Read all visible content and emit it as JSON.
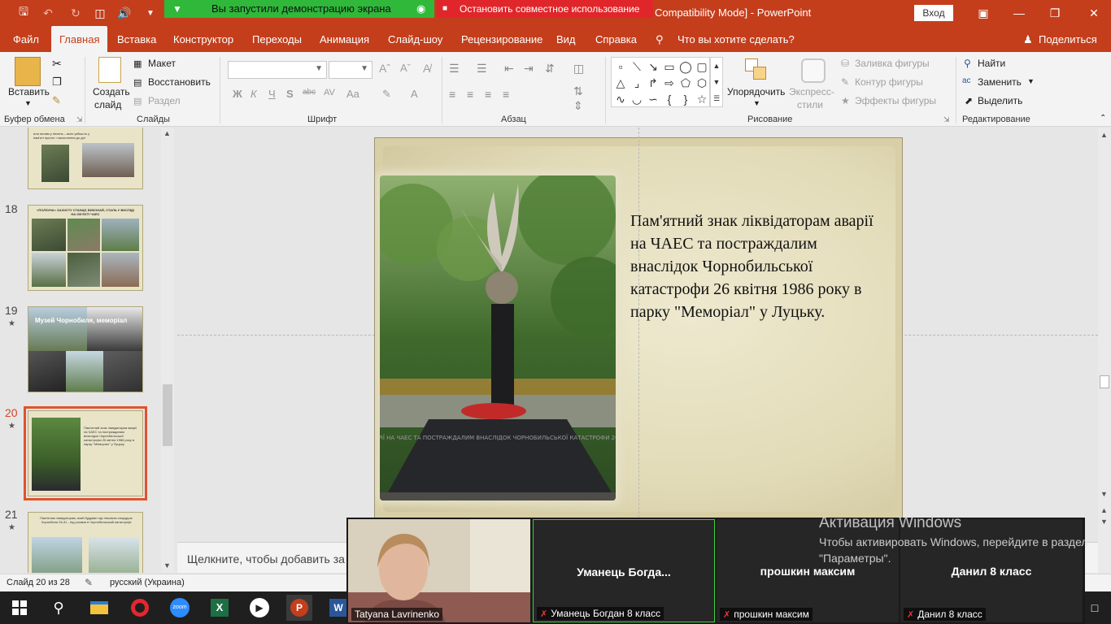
{
  "titlebar": {
    "share_banner": "Вы запустили демонстрацию экрана",
    "stop_sharing": "Остановить совместное использование",
    "doc_title": "Compatibility Mode]  -  PowerPoint",
    "signin": "Вход"
  },
  "tabs": [
    "Файл",
    "Главная",
    "Вставка",
    "Конструктор",
    "Переходы",
    "Анимация",
    "Слайд-шоу",
    "Рецензирование",
    "Вид",
    "Справка"
  ],
  "tell_me": "Что вы хотите сделать?",
  "share": "Поделиться",
  "ribbon": {
    "paste": "Вставить",
    "clipboard": "Буфер обмена",
    "new_slide_1": "Создать",
    "new_slide_2": "слайд",
    "layout": "Макет",
    "reset": "Восстановить",
    "section": "Раздел",
    "slides": "Слайды",
    "font_group": "Шрифт",
    "paragraph_group": "Абзац",
    "arrange": "Упорядочить",
    "quick_styles_1": "Экспресс-",
    "quick_styles_2": "стили",
    "shape_fill": "Заливка фигуры",
    "shape_outline": "Контур фигуры",
    "shape_effects": "Эффекты фигуры",
    "drawing_group": "Рисование",
    "find": "Найти",
    "replace": "Заменить",
    "select": "Выделить",
    "editing_group": "Редактирование"
  },
  "thumbnails": [
    {
      "num": "18",
      "star": ""
    },
    {
      "num": "19",
      "star": "★"
    },
    {
      "num": "20",
      "star": "★"
    },
    {
      "num": "21",
      "star": "★"
    }
  ],
  "thumb_texts": {
    "t17": "или пилам у печень – всех узбысло у пам'яті пролог і нахоплення до дні",
    "t18": "«ПОЛЗУНА» ЗАХИСТУ СТАНЦІЇ, ВИКОНАЙ, СТАЛЬ У ВИСЛІДІ НА ОБ'ЄКТІ ЧАЕС",
    "t19": "Музей Чорнобиля, меморіал",
    "t20": "Пам'ятний знак ліквідаторам аварії на ЧАЕС та постраждалим внаслідок Чорнобильської катастрофи 26 квітня 1986 року в парку \"Меморіал\" у Луцьку.",
    "t21": "Пам'ятник ліквідаторам, який будуван під тіньовою спорудою Чорнобиля 26-31 - під роками в Чорнобильській катастрофі"
  },
  "slide": {
    "text": "Пам'ятний знак ліквідаторам аварії на ЧАЕС та постраждалим внаслідок Чорнобильської катастрофи 26 квітня 1986 року в парку \"Меморіал\" у Луцьку.",
    "plaque": "ЛІКВІДАТОРАМ АВАРІЇ НА ЧАЕС ТА ПОСТРАЖДАЛИМ ВНАСЛІДОК ЧОРНОБИЛЬСЬКОЇ КАТАСТРОФИ 26 КВІТНЯ 1986 РОКУ"
  },
  "notes_placeholder": "Щелкните, чтобы добавить за",
  "status": {
    "slide_info": "Слайд 20 из 28",
    "language": "русский (Украина)"
  },
  "video": {
    "self_name": "Tatyana Lavrinenko",
    "tiles": [
      {
        "name": "Уманець  Богда...",
        "label": "Уманець Богдан 8 класс"
      },
      {
        "name": "прошкин максим",
        "label": "прошкин максим"
      },
      {
        "name": "Данил 8 класс",
        "label": "Данил 8 класс"
      }
    ]
  },
  "activation": {
    "title": "Активация Windows",
    "body": "Чтобы активировать Windows, перейдите в раздел \"Параметры\"."
  },
  "colors": {
    "accent": "#c43e1c",
    "banner_green": "#2fb83a",
    "banner_red": "#e0262a",
    "selected_outline": "#e0532b"
  }
}
